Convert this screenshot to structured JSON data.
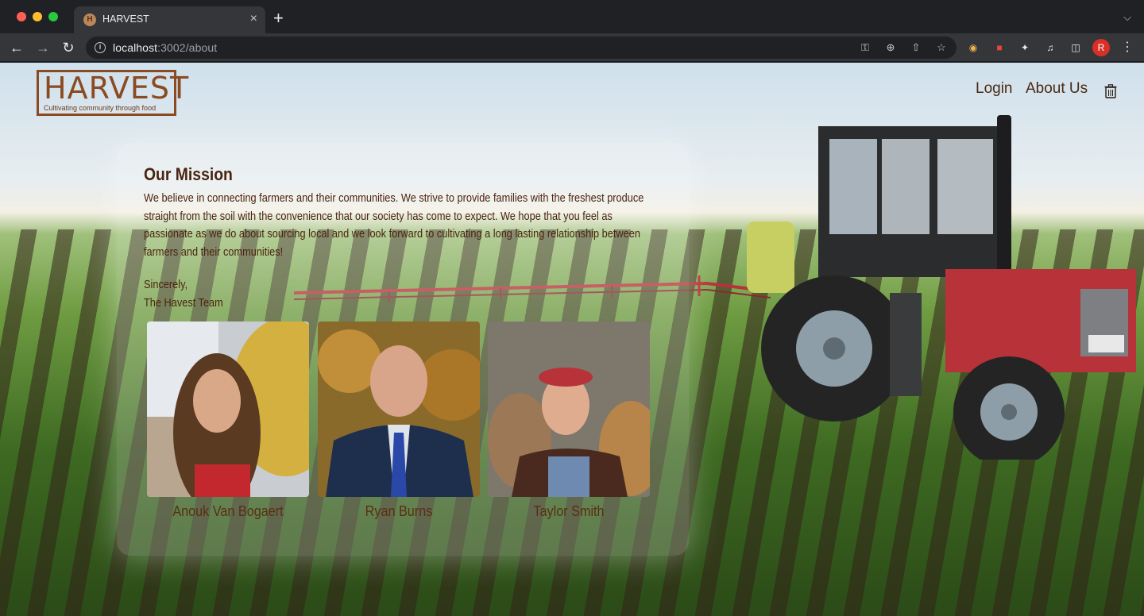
{
  "browser": {
    "tab_title": "HARVEST",
    "tab_favicon_letter": "H",
    "url_host": "localhost",
    "url_path": ":3002/about",
    "profile_initial": "R"
  },
  "site": {
    "logo_word": "HARVEST",
    "logo_tagline": "Cultivating community through food",
    "nav": {
      "login": "Login",
      "about": "About Us"
    }
  },
  "mission": {
    "title": "Our Mission",
    "body": "We believe in connecting farmers and their communities. We strive to provide families with the freshest produce straight from the soil with the convenience that our society has come to expect. We hope that you feel as passionate as we do about sourcing local and we look forward to cultivating a long lasting relationship between farmers and their communities!",
    "signoff_line1": "Sincerely,",
    "signoff_line2": "The Havest Team"
  },
  "team": [
    {
      "name": "Anouk Van Bogaert"
    },
    {
      "name": "Ryan Burns"
    },
    {
      "name": "Taylor Smith"
    }
  ],
  "colors": {
    "brand_brown": "#8a4a22",
    "text_brown": "#4a2410",
    "chrome_dark": "#202124",
    "chrome_toolbar": "#35363a"
  }
}
